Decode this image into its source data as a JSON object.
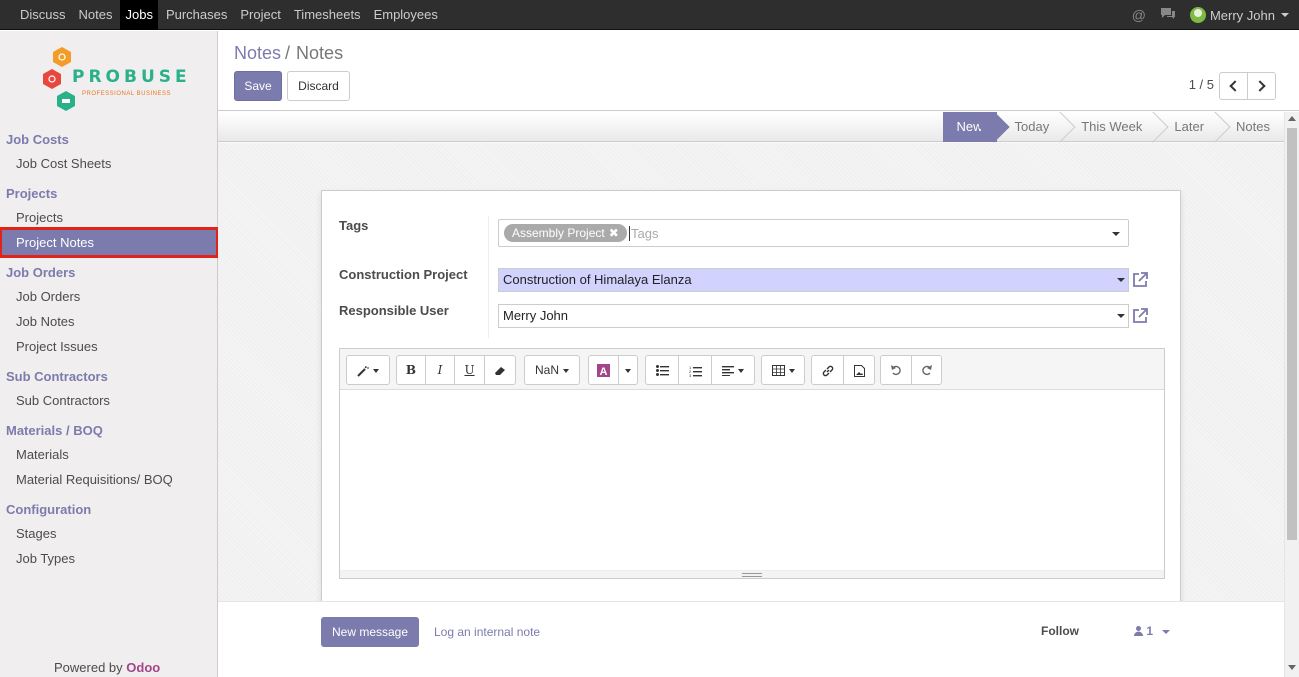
{
  "topbar": {
    "menu": [
      "Discuss",
      "Notes",
      "Jobs",
      "Purchases",
      "Project",
      "Timesheets",
      "Employees"
    ],
    "active_index": 2,
    "user_name": "Merry John",
    "icons": [
      "at-icon",
      "chat-icon"
    ]
  },
  "logo": {
    "word": "PROBUSE",
    "tagline": "PROFESSIONAL BUSINESS"
  },
  "sidebar": {
    "sections": [
      {
        "title": "Job Costs",
        "items": [
          "Job Cost Sheets"
        ]
      },
      {
        "title": "Projects",
        "items": [
          "Projects",
          "Project Notes"
        ]
      },
      {
        "title": "Job Orders",
        "items": [
          "Job Orders",
          "Job Notes",
          "Project Issues"
        ]
      },
      {
        "title": "Sub Contractors",
        "items": [
          "Sub Contractors"
        ]
      },
      {
        "title": "Materials / BOQ",
        "items": [
          "Materials",
          "Material Requisitions/ BOQ"
        ]
      },
      {
        "title": "Configuration",
        "items": [
          "Stages",
          "Job Types"
        ]
      }
    ],
    "active_item": "Project Notes",
    "powered_by": "Powered by",
    "powered_brand": "Odoo"
  },
  "control_panel": {
    "breadcrumb_parent": "Notes",
    "breadcrumb_sep": "/",
    "breadcrumb_current": "Notes",
    "save_label": "Save",
    "discard_label": "Discard",
    "pager": "1 / 5"
  },
  "statusbar": {
    "stages": [
      "New",
      "Today",
      "This Week",
      "Later",
      "Notes"
    ],
    "active_stage": "New"
  },
  "form": {
    "tags_label": "Tags",
    "tags": [
      "Assembly Project"
    ],
    "tags_placeholder": "Tags",
    "project_label": "Construction Project",
    "project_value": "Construction of Himalaya Elanza",
    "user_label": "Responsible User",
    "user_value": "Merry John"
  },
  "editor": {
    "font_size_label": "NaN",
    "content": ""
  },
  "chatter": {
    "new_message": "New message",
    "log_note": "Log an internal note",
    "follow": "Follow",
    "followers_count": "1"
  },
  "colors": {
    "brand": "#7c7bad",
    "highlight_input": "#d2d2ff",
    "selected_outline": "#e2231a"
  }
}
